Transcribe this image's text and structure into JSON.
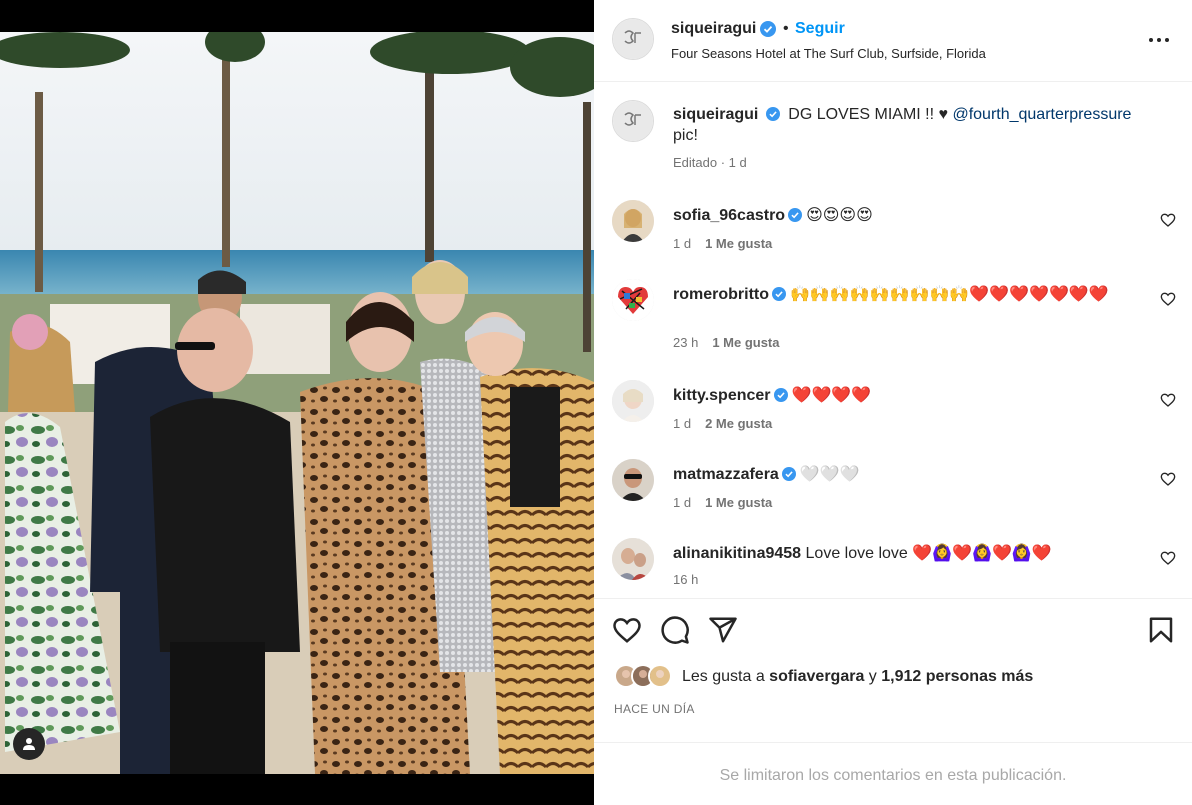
{
  "post": {
    "username": "siqueiragui",
    "follow_label": "Seguir",
    "separator": "•",
    "location": "Four Seasons Hotel at The Surf Club, Surfside, Florida",
    "caption_text": " DG LOVES MIAMI !! ♥ ",
    "caption_mention": "@fourth_quarterpressure",
    "caption_tail": " pic!",
    "caption_meta": "Editado · 1 d"
  },
  "comments": [
    {
      "user": "sofia_96castro",
      "verified": true,
      "text": "😍😍😍😍",
      "time": "1 d",
      "likes": "1 Me gusta"
    },
    {
      "user": "romerobritto",
      "verified": true,
      "text": "🙌🙌🙌🙌🙌🙌🙌🙌🙌❤️❤️❤️❤️❤️❤️❤️",
      "time": "23 h",
      "likes": "1 Me gusta"
    },
    {
      "user": "kitty.spencer",
      "verified": true,
      "text": "❤️❤️❤️❤️",
      "time": "1 d",
      "likes": "2 Me gusta"
    },
    {
      "user": "matmazzafera",
      "verified": true,
      "text": "🤍🤍🤍",
      "time": "1 d",
      "likes": "1 Me gusta"
    },
    {
      "user": "alinanikitina9458",
      "verified": false,
      "text": "Love love love ❤️🙆‍♀️❤️🙆‍♀️❤️🙆‍♀️❤️",
      "time": "16 h",
      "likes": ""
    }
  ],
  "likes": {
    "prefix": "Les gusta a ",
    "top_user": "sofiavergara",
    "middle": " y ",
    "count": "1,912 personas más"
  },
  "post_date": "HACE UN DÍA",
  "comments_limited": "Se limitaron los comentarios en esta publicación.",
  "colors": {
    "accent": "#0095f6",
    "verified": "#3897f0",
    "mention": "#00376b",
    "muted": "#737373"
  },
  "icons": [
    "more-icon",
    "verified-icon",
    "heart-icon",
    "comment-icon",
    "share-icon",
    "bookmark-icon",
    "user-tag-icon"
  ]
}
